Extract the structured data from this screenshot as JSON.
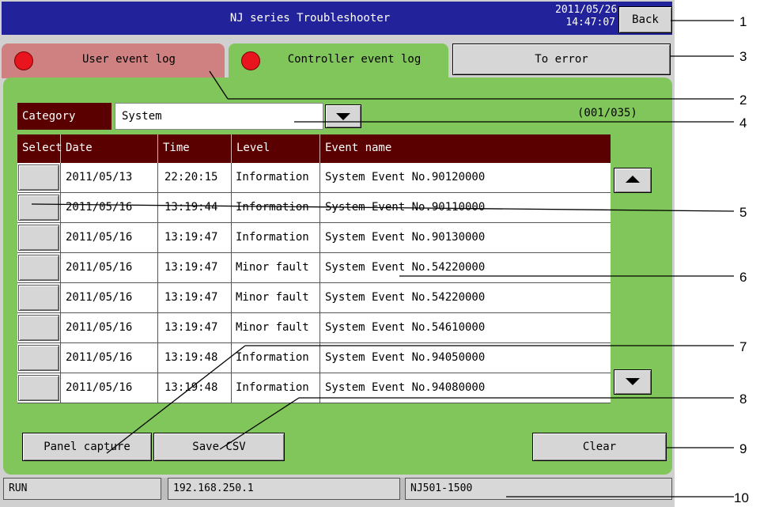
{
  "header": {
    "title": "NJ series Troubleshooter",
    "date": "2011/05/26",
    "time": "14:47:07",
    "back_label": "Back"
  },
  "tabs": [
    {
      "label": "User event log"
    },
    {
      "label": "Controller event log"
    }
  ],
  "to_error_label": "To error",
  "category": {
    "label": "Category",
    "value": "System"
  },
  "page_count": "(001/035)",
  "table": {
    "columns": [
      "Select",
      "Date",
      "Time",
      "Level",
      "Event name"
    ],
    "rows": [
      {
        "date": "2011/05/13",
        "time": "22:20:15",
        "level": "Information",
        "event": "System Event No.90120000"
      },
      {
        "date": "2011/05/16",
        "time": "13:19:44",
        "level": "Information",
        "event": "System Event No.90110000"
      },
      {
        "date": "2011/05/16",
        "time": "13:19:47",
        "level": "Information",
        "event": "System Event No.90130000"
      },
      {
        "date": "2011/05/16",
        "time": "13:19:47",
        "level": "Minor fault",
        "event": "System Event No.54220000"
      },
      {
        "date": "2011/05/16",
        "time": "13:19:47",
        "level": "Minor fault",
        "event": "System Event No.54220000"
      },
      {
        "date": "2011/05/16",
        "time": "13:19:47",
        "level": "Minor fault",
        "event": "System Event No.54610000"
      },
      {
        "date": "2011/05/16",
        "time": "13:19:48",
        "level": "Information",
        "event": "System Event No.94050000"
      },
      {
        "date": "2011/05/16",
        "time": "13:19:48",
        "level": "Information",
        "event": "System Event No.94080000"
      }
    ]
  },
  "buttons": {
    "panel_capture": "Panel capture",
    "save_csv": "Save CSV",
    "clear": "Clear"
  },
  "status": {
    "mode": "RUN",
    "ip": "192.168.250.1",
    "model": "NJ501-1500"
  },
  "annotations": [
    "1",
    "2",
    "3",
    "4",
    "5",
    "6",
    "7",
    "8",
    "9",
    "10"
  ],
  "colors": {
    "title_bar": "#22229a",
    "panel_green": "#80c65a",
    "user_tab": "#cf8080",
    "header_maroon": "#5a0000",
    "led_red": "#e8141e"
  }
}
